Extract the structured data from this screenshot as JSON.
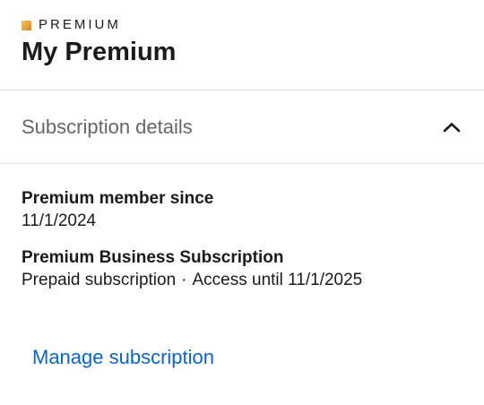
{
  "brand": {
    "label": "PREMIUM",
    "accent_color": "#e7a33e"
  },
  "page": {
    "title": "My Premium"
  },
  "subscription_section": {
    "title": "Subscription details",
    "toggle_icon": "chevron-up-icon",
    "expanded": true,
    "member_since_label": "Premium member since",
    "member_since_value": "11/1/2024",
    "plan_name": "Premium Business Subscription",
    "plan_type": "Prepaid subscription",
    "separator": "·",
    "access_text": "Access until 11/1/2025"
  },
  "actions": {
    "manage_label": "Manage subscription",
    "link_color": "#0a66c2"
  }
}
